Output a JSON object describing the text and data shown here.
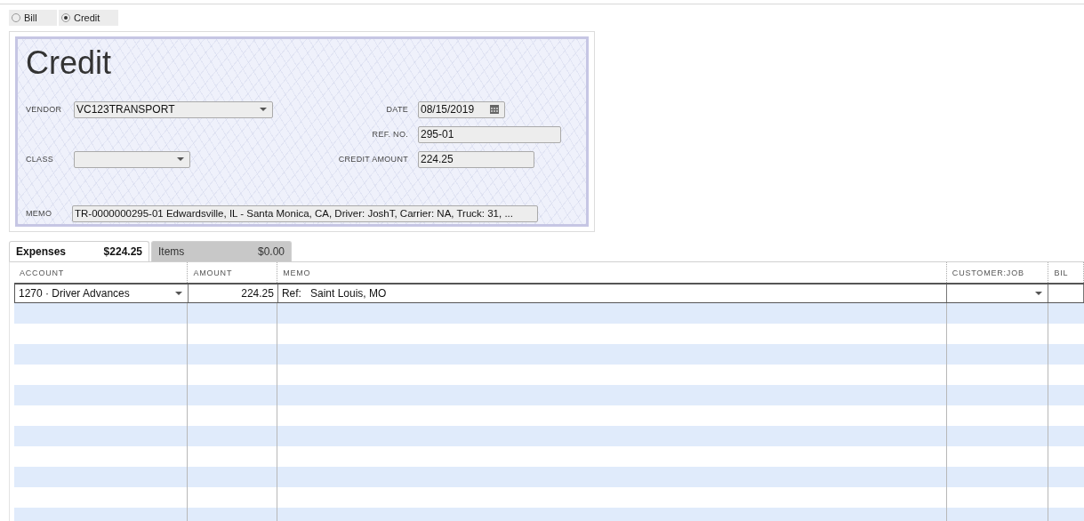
{
  "mode_toggle": [
    {
      "label": "Bill",
      "selected": false
    },
    {
      "label": "Credit",
      "selected": true
    }
  ],
  "form": {
    "title": "Credit",
    "vendor": {
      "label": "VENDOR",
      "value": "VC123TRANSPORT"
    },
    "date": {
      "label": "DATE",
      "value": "08/15/2019"
    },
    "ref_no": {
      "label": "REF. NO.",
      "value": "295-01"
    },
    "class": {
      "label": "CLASS"
    },
    "credit_amount": {
      "label": "CREDIT AMOUNT",
      "value": "224.25"
    },
    "memo": {
      "label": "MEMO",
      "value": "TR-0000000295-01 Edwardsville, IL - Santa Monica, CA, Driver: JoshT, Carrier: NA, Truck: 31, ..."
    }
  },
  "tabs": [
    {
      "label": "Expenses",
      "amount": "$224.25",
      "selected": true
    },
    {
      "label": "Items",
      "amount": "$0.00",
      "selected": false
    }
  ],
  "table": {
    "columns": [
      "ACCOUNT",
      "AMOUNT",
      "MEMO",
      "CUSTOMER:JOB",
      "BIL"
    ],
    "rows": [
      {
        "account": "1270 · Driver Advances",
        "amount": "224.25",
        "memo": "Ref:   Saint Louis, MO"
      }
    ]
  }
}
